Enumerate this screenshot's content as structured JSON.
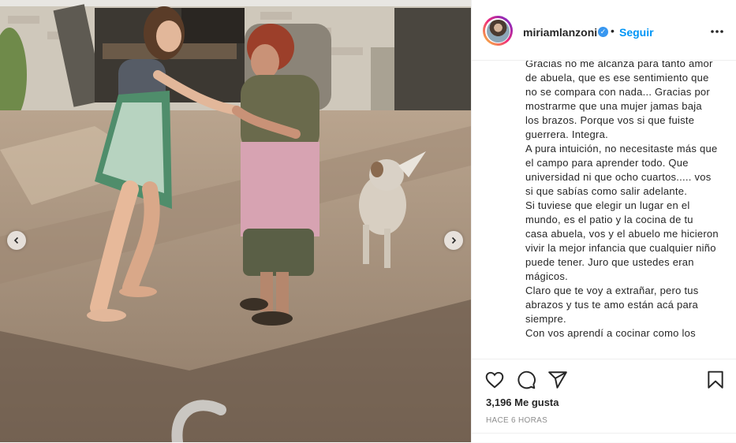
{
  "post": {
    "media_alt": "",
    "nav_prev_icon": "chevron-left-icon",
    "nav_next_icon": "chevron-right-icon"
  },
  "header": {
    "username": "miriamlanzoni",
    "verified_icon": "verified-badge-icon",
    "separator": "•",
    "follow_label": "Seguir",
    "more_icon": "more-options-icon"
  },
  "caption": {
    "paragraphs": [
      "Gracias no me alcanza para tanto amor de abuela, que es ese sentimiento que no se compara con nada... Gracias por mostrarme que una mujer jamas baja los brazos. Porque vos si que fuiste guerrera. Integra.",
      "A pura intuición, no necesitaste más que el campo para aprender todo. Que universidad ni que ocho cuartos..... vos si que sabías como salir adelante.",
      "Si tuviese que elegir un lugar en el mundo, es el patio y la cocina de tu casa abuela, vos y el abuelo me hicieron vivir la mejor infancia que cualquier niño puede tener. Juro que ustedes eran mágicos.",
      "Claro que te voy a extrañar, pero tus abrazos y tus te amo están acá para siempre.",
      "Con vos aprendí a cocinar como los"
    ]
  },
  "actions": {
    "like_icon": "heart-icon",
    "comment_icon": "comment-icon",
    "share_icon": "share-icon",
    "save_icon": "bookmark-icon",
    "likes_text": "3,196 Me gusta",
    "time_text": "HACE 6 HORAS"
  },
  "colors": {
    "follow": "#0095f6",
    "text": "#262626",
    "muted": "#8e8e8e",
    "border": "#efefef",
    "verified": "#3897f0"
  }
}
